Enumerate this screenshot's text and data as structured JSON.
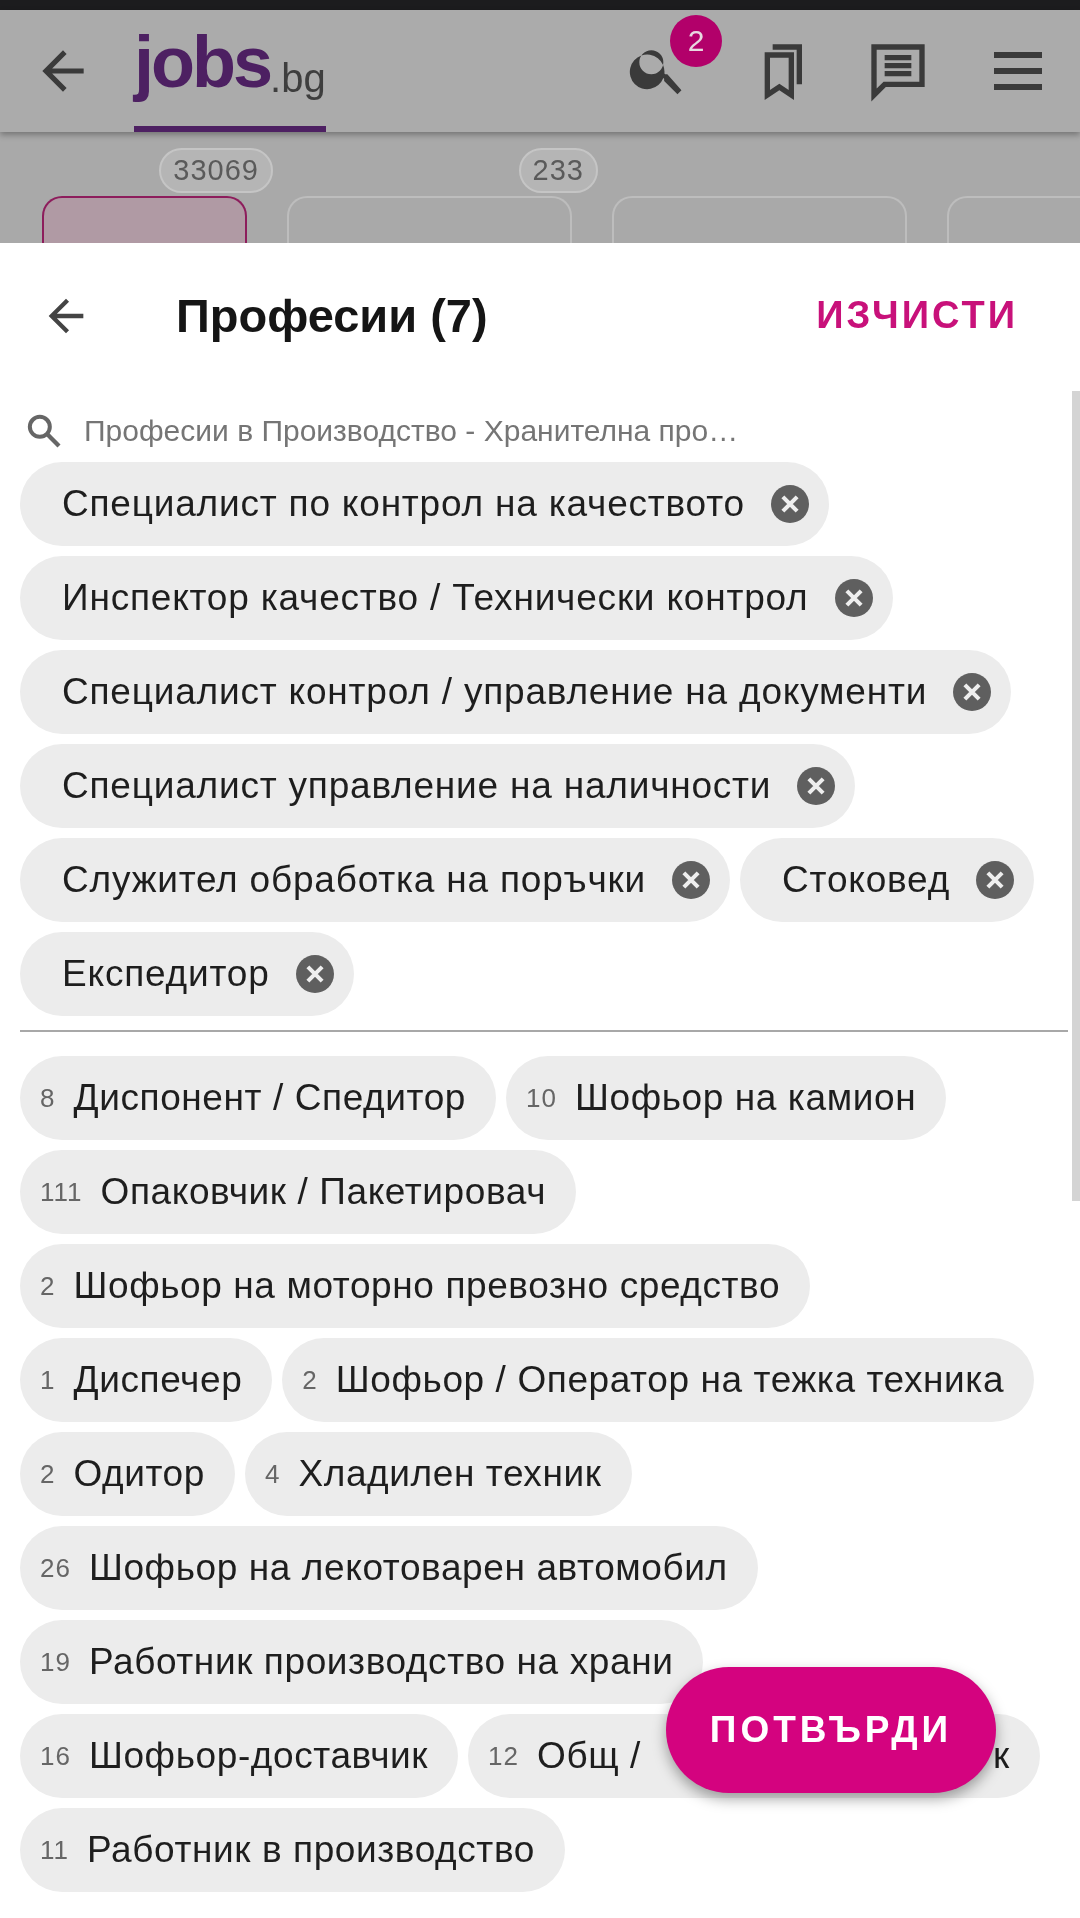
{
  "header": {
    "logo": {
      "word": "jobs",
      "suffix": ".bg"
    },
    "search_badge": "2"
  },
  "category_cards": [
    {
      "count": "33069",
      "selected": true
    },
    {
      "count": "233",
      "selected": false
    },
    {
      "selected": false
    },
    {
      "selected": false
    }
  ],
  "sheet": {
    "title": "Професии (7)",
    "clear": "ИЗЧИСТИ",
    "search": {
      "placeholder": "Професии в Производство - Хранителна про…"
    },
    "selected": [
      "Специалист по контрол на качеството",
      "Инспектор качество / Технически контрол",
      "Специалист контрол / управление на документи",
      "Специалист управление на наличности",
      "Служител обработка на поръчки",
      "Стоковед",
      "Експедитор"
    ],
    "suggestions": [
      {
        "count": "8",
        "label": "Диспонент / Спедитор"
      },
      {
        "count": "10",
        "label": "Шофьор на камион"
      },
      {
        "count": "111",
        "label": "Опаковчик / Пакетировач"
      },
      {
        "count": "2",
        "label": "Шофьор на моторно превозно средство"
      },
      {
        "count": "1",
        "label": "Диспечер"
      },
      {
        "count": "2",
        "label": "Шофьор / Оператор на тежка техника"
      },
      {
        "count": "2",
        "label": "Одитор"
      },
      {
        "count": "4",
        "label": "Хладилен техник"
      },
      {
        "count": "26",
        "label": "Шофьор на лекотоварен автомобил"
      },
      {
        "count": "19",
        "label": "Работник производство на храни"
      },
      {
        "count": "16",
        "label": "Шофьор-доставчик"
      },
      {
        "count": "12",
        "label": "Общ /",
        "label_end": "к"
      },
      {
        "count": "11",
        "label": "Работник в производство"
      }
    ],
    "confirm": "ПОТВЪРДИ"
  }
}
